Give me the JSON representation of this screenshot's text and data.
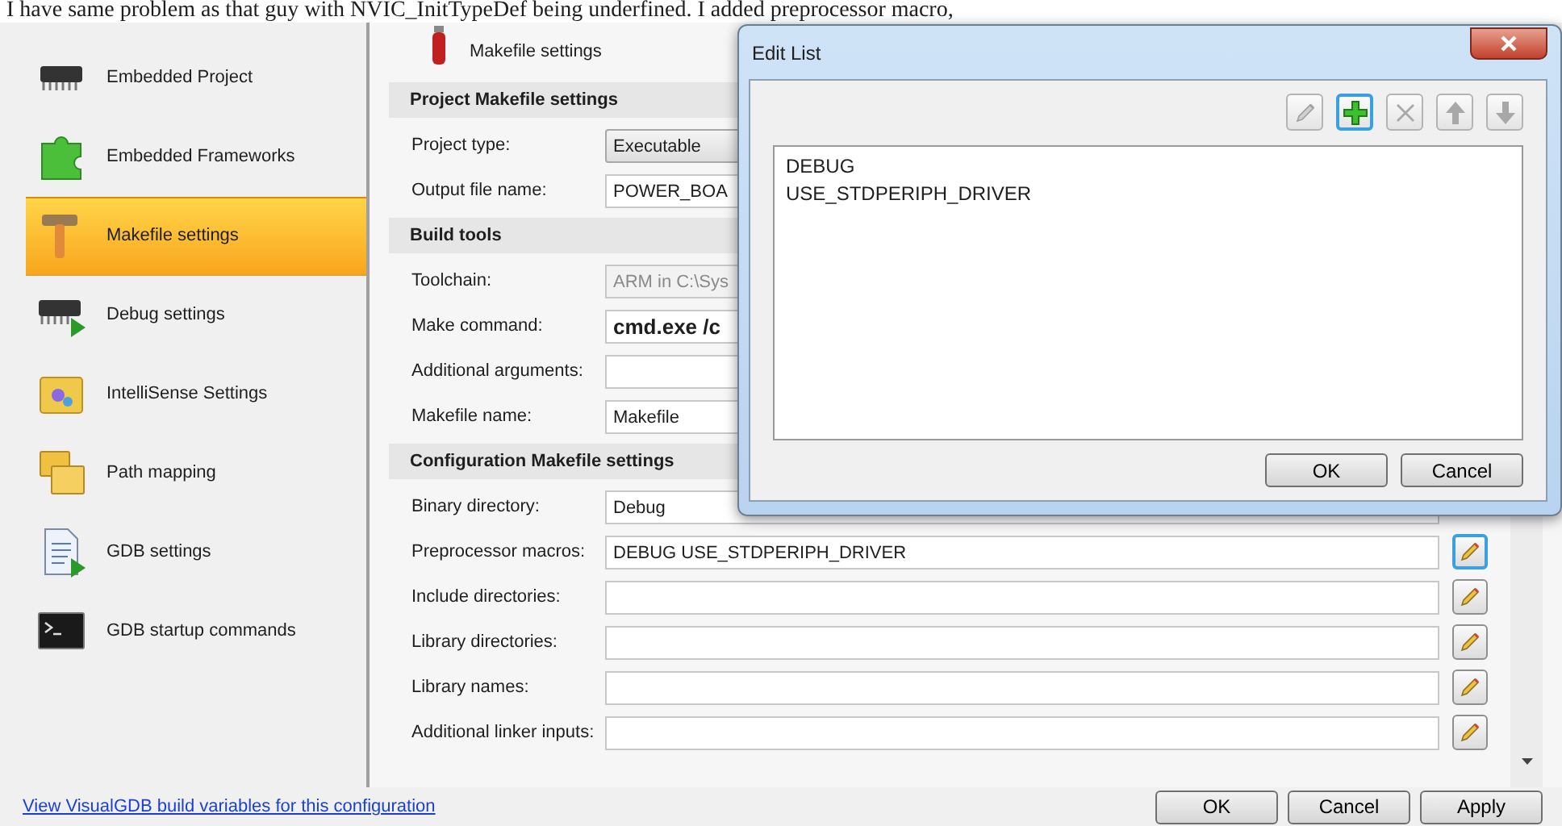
{
  "question_text": "I have same problem as that guy with NVIC_InitTypeDef being underfined. I added preprocessor macro,",
  "sidebar": {
    "items": [
      {
        "label": "Embedded Project",
        "kind": "chip",
        "selected": false
      },
      {
        "label": "Embedded Frameworks",
        "kind": "puzzle",
        "selected": false
      },
      {
        "label": "Makefile settings",
        "kind": "hammer",
        "selected": true
      },
      {
        "label": "Debug settings",
        "kind": "chip-play",
        "selected": false
      },
      {
        "label": "IntelliSense Settings",
        "kind": "intellisense",
        "selected": false
      },
      {
        "label": "Path mapping",
        "kind": "folders",
        "selected": false
      },
      {
        "label": "GDB settings",
        "kind": "doc-play",
        "selected": false
      },
      {
        "label": "GDB startup commands",
        "kind": "terminal",
        "selected": false
      }
    ]
  },
  "panel": {
    "title": "Makefile settings",
    "sections": [
      {
        "title": "Project Makefile settings",
        "rows": [
          {
            "label": "Project type:",
            "value": "Executable",
            "kind": "dropdown",
            "disabled": false,
            "bold": false
          },
          {
            "label": "Output file name:",
            "value": "POWER_BOA",
            "kind": "text",
            "disabled": false,
            "bold": false
          }
        ]
      },
      {
        "title": "Build tools",
        "rows": [
          {
            "label": "Toolchain:",
            "value": "ARM in C:\\Sys",
            "kind": "text",
            "disabled": true,
            "bold": false
          },
          {
            "label": "Make command:",
            "value": "cmd.exe /c",
            "kind": "text",
            "disabled": false,
            "bold": true
          },
          {
            "label": "Additional arguments:",
            "kind": "text",
            "disabled": false
          },
          {
            "label": "Makefile name:",
            "value": "Makefile",
            "kind": "text",
            "disabled": false,
            "bold": false
          }
        ]
      },
      {
        "title": "Configuration Makefile settings",
        "rows": [
          {
            "label": "Binary directory:",
            "value": "Debug",
            "kind": "text",
            "disabled": false,
            "bold": false
          },
          {
            "label": "Preprocessor macros:",
            "value": "DEBUG USE_STDPERIPH_DRIVER",
            "kind": "list",
            "disabled": false,
            "bold": false,
            "focused": true
          },
          {
            "label": "Include directories:",
            "kind": "list",
            "disabled": false,
            "focused": false
          },
          {
            "label": "Library directories:",
            "kind": "list",
            "disabled": false,
            "focused": false
          },
          {
            "label": "Library names:",
            "kind": "list",
            "disabled": false,
            "focused": false
          },
          {
            "label": "Additional linker inputs:",
            "kind": "list",
            "disabled": false,
            "focused": false
          }
        ]
      }
    ]
  },
  "dialog": {
    "title": "Edit List",
    "tools": [
      {
        "kind": "edit",
        "disabled": true,
        "focused": false
      },
      {
        "kind": "add",
        "disabled": false,
        "focused": true
      },
      {
        "kind": "delete",
        "disabled": true,
        "focused": false
      },
      {
        "kind": "up",
        "disabled": true,
        "focused": false
      },
      {
        "kind": "down",
        "disabled": true,
        "focused": false
      }
    ],
    "items": [
      "DEBUG",
      "USE_STDPERIPH_DRIVER"
    ],
    "buttons": [
      "OK",
      "Cancel"
    ]
  },
  "footer": {
    "link": "View VisualGDB build variables for this configuration",
    "buttons": [
      "OK",
      "Cancel",
      "Apply"
    ]
  }
}
